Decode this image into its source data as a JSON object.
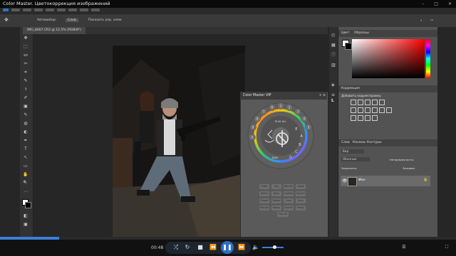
{
  "window": {
    "title": "Color Master. Цветокоррекция изображений",
    "controls": [
      "–",
      "□",
      "✕"
    ]
  },
  "photoshop": {
    "options_bar": {
      "autoselect_label": "Автовыбор:",
      "autoselect_value": "Слой",
      "transform_label": "Показать упр. элем."
    },
    "document_tab": "IMG_8467.CR2 @ 12,5% (RGB/8*)",
    "tools": [
      "✥",
      "⬚",
      "ᔕ",
      "✂",
      "⌗",
      "✎",
      "⚕",
      "✐",
      "▣",
      "✎",
      "◍",
      "◐",
      "✒",
      "T",
      "↖",
      "▭",
      "✋",
      "🔍",
      "⋯",
      "◧",
      "▣"
    ],
    "right_dock_icons": [
      "◴",
      "▦",
      "ⓘ",
      "▥",
      "◈",
      "≡",
      "Ɫ"
    ],
    "color_panel": {
      "tabs": [
        "Цвет",
        "Образцы"
      ]
    },
    "adjustments_panel": {
      "tab": "Коррекция",
      "hint": "Добавить корректировку"
    },
    "layers_panel": {
      "tabs": [
        "Слои",
        "Каналы",
        "Контуры"
      ],
      "kind_label": "Вид",
      "blend_mode": "Обычные",
      "opacity_label": "Непрозрачность:",
      "lock_label": "Закрепить:",
      "fill_label": "Заливка:",
      "layer_name": "Фон"
    }
  },
  "color_master": {
    "title": "Color Master VIP",
    "wheel_center_top": "PLAY ALL",
    "wheel_center_bottom": "RAW",
    "wheel_digits": [
      "1",
      "2",
      "3",
      "4",
      "5",
      "6",
      "7",
      "8",
      "9",
      "0"
    ],
    "wheel_letters": [
      "A",
      "B",
      "C",
      "D",
      "E"
    ],
    "presets": [
      [
        "Elder",
        "Airy",
        "Bonfire",
        "Greek"
      ],
      [
        "Salina",
        "Bass",
        "Loofied",
        "Severe"
      ],
      [
        "Proper",
        "Fabled",
        "Luxe",
        "Early"
      ],
      [
        "Secular",
        "Heavy",
        "Soothe",
        "Pretty"
      ]
    ],
    "play_all_label": "Play All"
  },
  "player": {
    "time": "00:48",
    "progress_fraction": 0.13,
    "volume_fraction": 0.55,
    "accent_color": "#3b7fd6",
    "buttons": [
      "shuffle-icon",
      "repeat-icon",
      "stop-icon",
      "previous-icon",
      "pause-icon",
      "next-icon",
      "volume-icon"
    ]
  }
}
